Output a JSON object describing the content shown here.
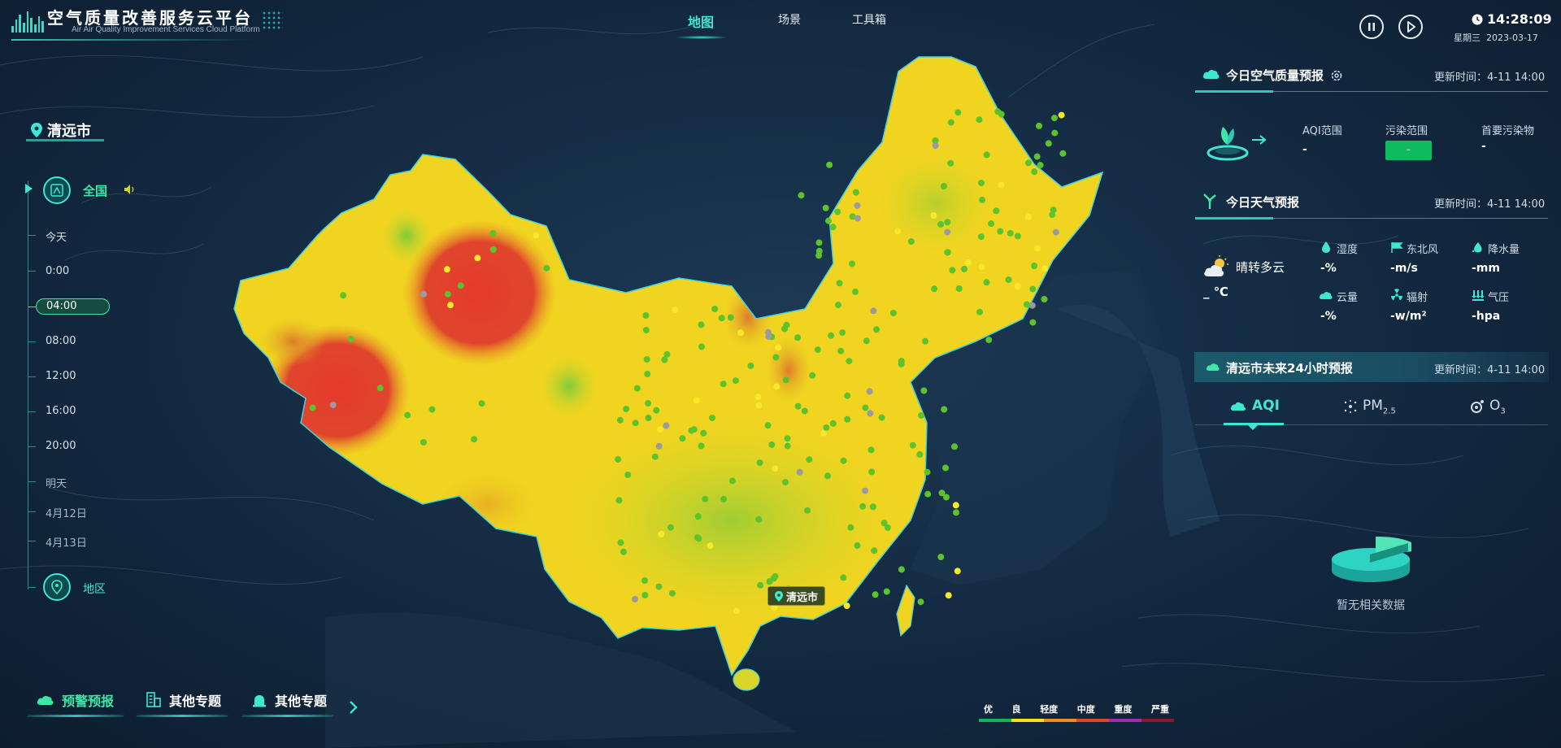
{
  "header": {
    "title_cn": "空气质量改善服务云平台",
    "title_en": "Air Air Quality Improvement Services Cloud Platform",
    "nav": [
      {
        "label": "地图",
        "active": true
      },
      {
        "label": "场景",
        "active": false
      },
      {
        "label": "工具箱",
        "active": false
      }
    ],
    "time": "14:28:09",
    "weekday": "星期三",
    "date": "2023-03-17",
    "icons": [
      "pause-icon",
      "play-icon",
      "clock-icon"
    ]
  },
  "left_panel": {
    "city": "清远市",
    "national_label": "全国",
    "timeline": [
      {
        "label": "今天",
        "kind": "day"
      },
      {
        "label": "0:00",
        "kind": "time"
      },
      {
        "label": "04:00",
        "kind": "time",
        "active": true
      },
      {
        "label": "08:00",
        "kind": "time"
      },
      {
        "label": "12:00",
        "kind": "time"
      },
      {
        "label": "16:00",
        "kind": "time"
      },
      {
        "label": "20:00",
        "kind": "time"
      },
      {
        "label": "明天",
        "kind": "day"
      },
      {
        "label": "4月12日",
        "kind": "day"
      },
      {
        "label": "4月13日",
        "kind": "day"
      }
    ],
    "region_label": "地区"
  },
  "bottom_buttons": [
    {
      "label": "预警预报",
      "active": true,
      "icon": "cloud-warning-icon"
    },
    {
      "label": "其他专题",
      "active": false,
      "icon": "building-icon"
    },
    {
      "label": "其他专题",
      "active": false,
      "icon": "alarm-icon"
    }
  ],
  "map": {
    "marker_label": "清远市"
  },
  "legend": {
    "labels": [
      "优",
      "良",
      "轻度",
      "中度",
      "重度",
      "严重"
    ],
    "colors": [
      "#16b45a",
      "#f5e21b",
      "#f08b1d",
      "#e8402c",
      "#9b2fb0",
      "#8a1a2a"
    ]
  },
  "air_quality": {
    "title": "今日空气质量预报",
    "update_label": "更新时间：4-11 14:00",
    "aqi_range_label": "AQI范围",
    "aqi_range_value": "-",
    "pollution_label": "污染范围",
    "pollution_value": "-",
    "primary_pollutant_label": "首要污染物",
    "primary_pollutant_value": "-"
  },
  "weather": {
    "title": "今日天气预报",
    "update_label": "更新时间：4-11 14:00",
    "condition": "晴转多云",
    "temperature": "_ ℃",
    "items": [
      {
        "label": "湿度",
        "value": "-%",
        "icon": "droplet-icon"
      },
      {
        "label": "东北风",
        "value": "-m/s",
        "icon": "wind-icon"
      },
      {
        "label": "降水量",
        "value": "-mm",
        "icon": "rain-icon"
      },
      {
        "label": "云量",
        "value": "-%",
        "icon": "cloud-icon"
      },
      {
        "label": "辐射",
        "value": "-w/m²",
        "icon": "radiation-icon"
      },
      {
        "label": "气压",
        "value": "-hpa",
        "icon": "pressure-icon"
      }
    ]
  },
  "forecast_24h": {
    "title": "清远市未来24小时预报",
    "update_label": "更新时间：4-11 14:00",
    "tabs": [
      {
        "label": "AQI",
        "active": true
      },
      {
        "label": "PM",
        "sub": "2.5",
        "active": false
      },
      {
        "label": "O",
        "sub": "3",
        "active": false
      }
    ],
    "no_data": "暂无相关数据"
  }
}
